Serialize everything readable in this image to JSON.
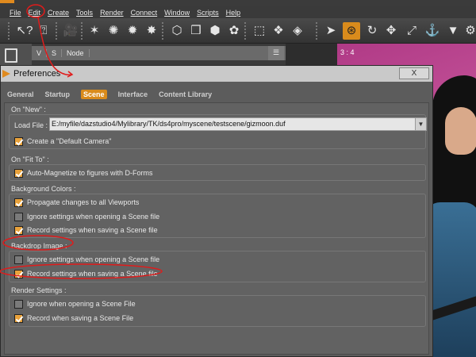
{
  "menu": [
    "File",
    "Edit",
    "Create",
    "Tools",
    "Render",
    "Connect",
    "Window",
    "Scripts",
    "Help"
  ],
  "scene_panel": {
    "col_v": "V",
    "col_s": "S",
    "col_node": "Node"
  },
  "viewport": {
    "label": "3 : 4"
  },
  "dialog": {
    "title": "Preferences",
    "close": "X",
    "tabs": [
      "General",
      "Startup",
      "Scene",
      "Interface",
      "Content Library"
    ],
    "active_tab": "Scene",
    "on_new": {
      "title": "On \"New\" :",
      "load_file_label": "Load File :",
      "load_file_value": "E:/myfile/dazstudio4/Mylibrary/TK/ds4pro/myscene/testscene/gizmoon.duf",
      "create_default_camera": "Create a \"Default Camera\""
    },
    "on_fit_to": {
      "title": "On \"Fit To\" :",
      "auto_magnetize": "Auto-Magnetize to figures with D-Forms"
    },
    "background_colors": {
      "title": "Background Colors :",
      "propagate": "Propagate changes to all Viewports",
      "ignore": "Ignore settings when opening a Scene file",
      "record": "Record settings when saving a Scene file"
    },
    "backdrop_image": {
      "title": "Backdrop Image :",
      "ignore": "Ignore settings when opening a Scene file",
      "record": "Record settings when saving a Scene file"
    },
    "render_settings": {
      "title": "Render Settings :",
      "ignore": "Ignore when opening a Scene File",
      "record": "Record when saving a Scene File"
    }
  },
  "checkboxes": {
    "create_default_camera": true,
    "auto_magnetize": true,
    "bg_propagate": true,
    "bg_ignore": false,
    "bg_record": true,
    "backdrop_ignore": false,
    "backdrop_record": true,
    "render_ignore": false,
    "render_record": true
  },
  "colors": {
    "accent": "#d98b1c",
    "checkbox_checked": "#e9a23b",
    "annotation": "#e01b1b"
  }
}
